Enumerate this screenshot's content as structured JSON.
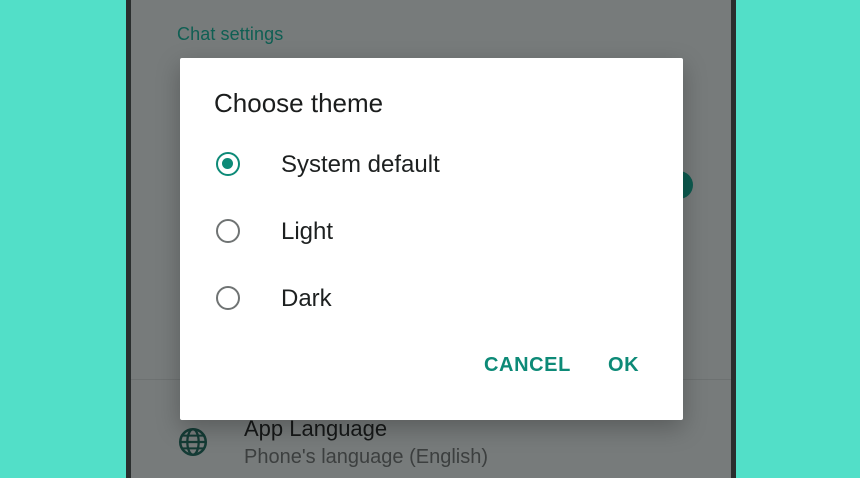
{
  "background": {
    "section_header": "Chat settings",
    "app_language_row": {
      "icon": "globe-icon",
      "title": "App Language",
      "subtitle": "Phone's language (English)"
    }
  },
  "dialog": {
    "title": "Choose theme",
    "options": [
      {
        "label": "System default",
        "selected": true
      },
      {
        "label": "Light",
        "selected": false
      },
      {
        "label": "Dark",
        "selected": false
      }
    ],
    "actions": {
      "cancel_label": "CANCEL",
      "ok_label": "OK"
    }
  },
  "colors": {
    "accent": "#0d8a77",
    "page_background": "#52dfc8",
    "scrim_background": "#777b7b"
  }
}
